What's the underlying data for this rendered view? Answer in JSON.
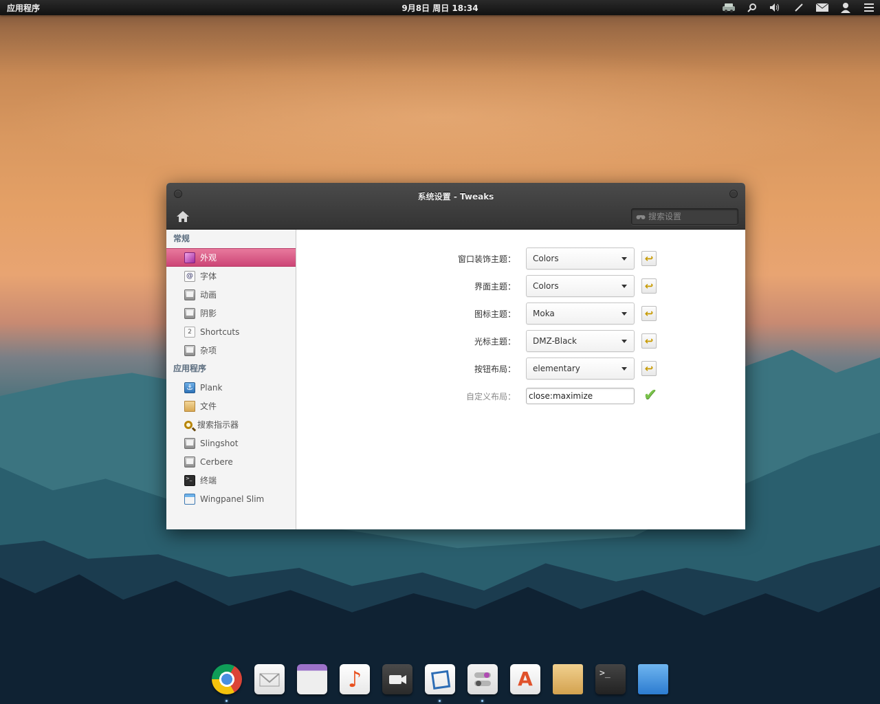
{
  "panel": {
    "apps_label": "应用程序",
    "clock": "9月8日 周日 18:34",
    "indicators": [
      "network-icon",
      "search-icon",
      "volume-icon",
      "pen-icon",
      "mail-icon",
      "user-icon",
      "menu-icon"
    ]
  },
  "window": {
    "title": "系统设置 - Tweaks",
    "search_placeholder": "搜索设置"
  },
  "sidebar": {
    "sections": [
      {
        "title": "常规",
        "items": [
          {
            "label": "外观",
            "icon": "appearance-icon",
            "selected": true
          },
          {
            "label": "字体",
            "icon": "font-icon"
          },
          {
            "label": "动画",
            "icon": "animation-icon"
          },
          {
            "label": "阴影",
            "icon": "shadow-icon"
          },
          {
            "label": "Shortcuts",
            "icon": "shortcuts-icon"
          },
          {
            "label": "杂项",
            "icon": "misc-icon"
          }
        ]
      },
      {
        "title": "应用程序",
        "items": [
          {
            "label": "Plank",
            "icon": "plank-icon"
          },
          {
            "label": "文件",
            "icon": "folder-icon"
          },
          {
            "label": "搜索指示器",
            "icon": "search-indicator-icon"
          },
          {
            "label": "Slingshot",
            "icon": "slingshot-icon"
          },
          {
            "label": "Cerbere",
            "icon": "cerbere-icon"
          },
          {
            "label": "终端",
            "icon": "terminal-icon"
          },
          {
            "label": "Wingpanel Slim",
            "icon": "wingpanel-icon"
          }
        ]
      }
    ]
  },
  "settings": {
    "window_theme": {
      "label": "窗口装饰主题：",
      "value": "Colors"
    },
    "ui_theme": {
      "label": "界面主题：",
      "value": "Colors"
    },
    "icon_theme": {
      "label": "图标主题：",
      "value": "Moka"
    },
    "cursor_theme": {
      "label": "光标主题：",
      "value": "DMZ-Black"
    },
    "button_layout": {
      "label": "按钮布局：",
      "value": "elementary"
    },
    "custom_layout": {
      "label": "自定义布局：",
      "value": "close:maximize"
    }
  },
  "dock": {
    "items": [
      "chrome-icon",
      "mail-icon",
      "calendar-icon",
      "music-icon",
      "video-icon",
      "photos-icon",
      "settings-icon",
      "app-center-icon",
      "files-icon",
      "terminal-icon",
      "desktop-icon"
    ]
  }
}
